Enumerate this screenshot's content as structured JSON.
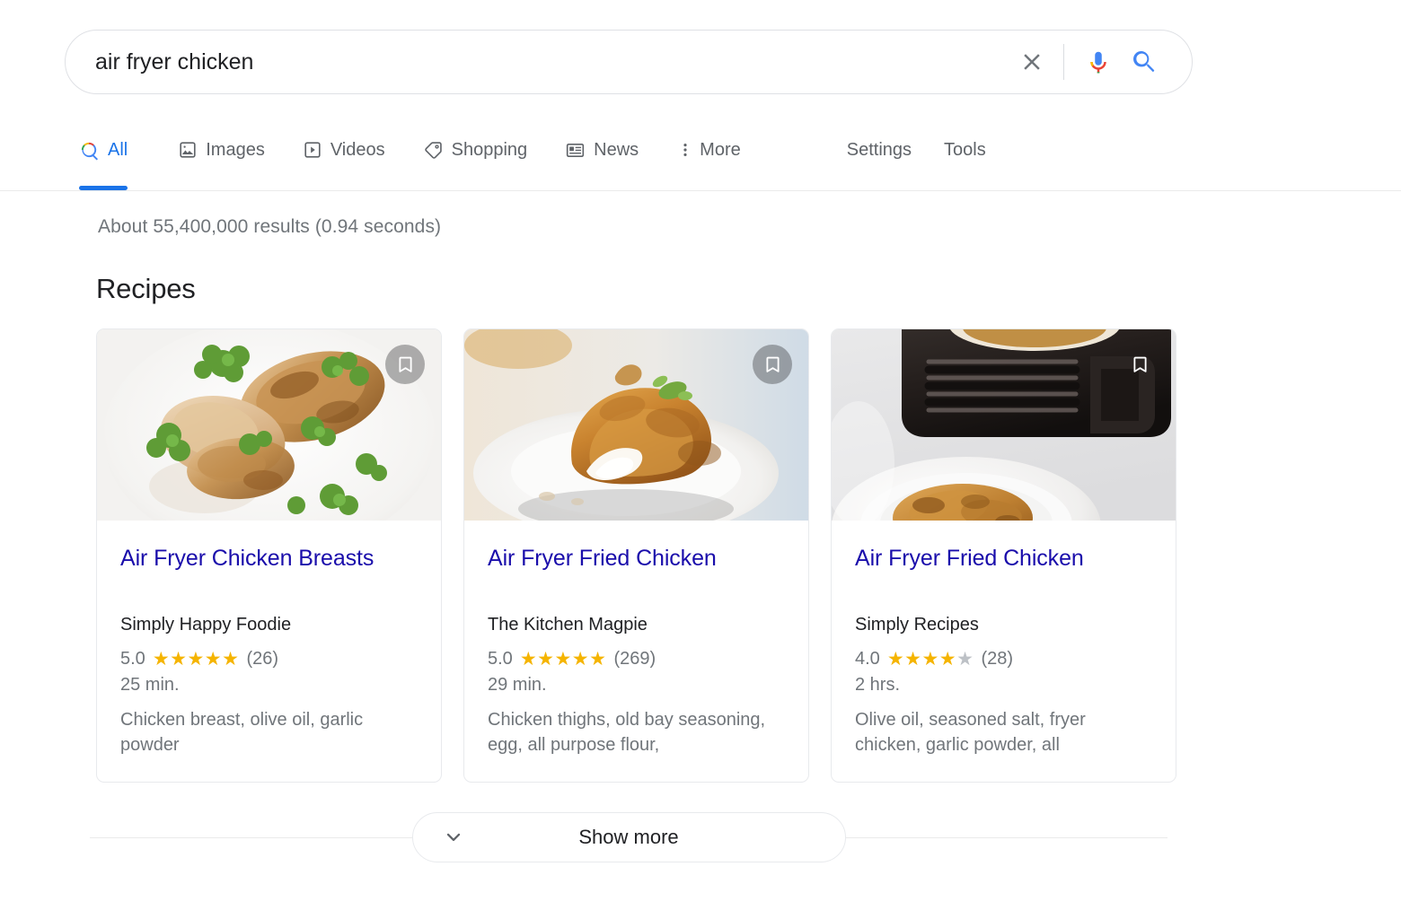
{
  "search": {
    "query": "air fryer chicken",
    "placeholder": "Search",
    "clear_icon": "close-icon",
    "mic_icon": "microphone-icon",
    "search_icon": "search-icon"
  },
  "nav": {
    "tabs": [
      {
        "label": "All",
        "icon": "search-icon",
        "active": true
      },
      {
        "label": "Images",
        "icon": "image-icon",
        "active": false
      },
      {
        "label": "Videos",
        "icon": "video-icon",
        "active": false
      },
      {
        "label": "Shopping",
        "icon": "tag-icon",
        "active": false
      },
      {
        "label": "News",
        "icon": "news-icon",
        "active": false
      },
      {
        "label": "More",
        "icon": "more-vert-icon",
        "active": false
      }
    ],
    "links": [
      {
        "label": "Settings"
      },
      {
        "label": "Tools"
      }
    ]
  },
  "results": {
    "stats": "About 55,400,000 results (0.94 seconds)",
    "section_title": "Recipes"
  },
  "recipes": [
    {
      "title": "Air Fryer Chicken Breasts",
      "source": "Simply Happy Foodie",
      "rating": "5.0",
      "stars_filled": 5,
      "reviews": "(26)",
      "time": "25 min.",
      "ingredients": "Chicken breast, olive oil, garlic powder",
      "bookmark_icon": "bookmark-icon",
      "bookmark_scrim": true
    },
    {
      "title": "Air Fryer Fried Chicken",
      "source": "The Kitchen Magpie",
      "rating": "5.0",
      "stars_filled": 5,
      "reviews": "(269)",
      "time": "29 min.",
      "ingredients": "Chicken thighs, old bay seasoning, egg, all purpose flour,",
      "bookmark_icon": "bookmark-icon",
      "bookmark_scrim": true
    },
    {
      "title": "Air Fryer Fried Chicken",
      "source": "Simply Recipes",
      "rating": "4.0",
      "stars_filled": 4,
      "reviews": "(28)",
      "time": "2 hrs.",
      "ingredients": "Olive oil, seasoned salt, fryer chicken, garlic powder, all",
      "bookmark_icon": "bookmark-icon",
      "bookmark_scrim": false
    }
  ],
  "show_more": {
    "label": "Show more",
    "icon": "chevron-down-icon"
  },
  "colors": {
    "link": "#1a0dab",
    "accent": "#1a73e8",
    "star": "#f5b400",
    "star_empty": "#bdc1c6",
    "muted_text": "#70757a"
  }
}
